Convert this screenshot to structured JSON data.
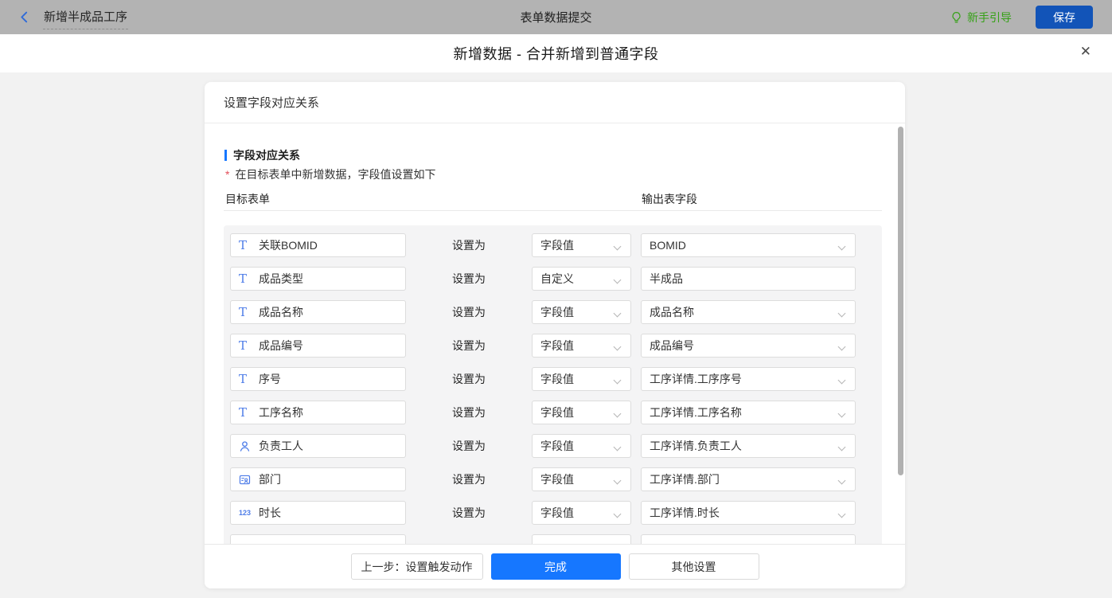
{
  "topbar": {
    "back_title": "新增半成品工序",
    "center_title": "表单数据提交",
    "guide_label": "新手引导",
    "save_label": "保存",
    "colors": {
      "bar_bg": "#b3b3b3",
      "save_bg": "#1254b8",
      "guide_green": "#35a116",
      "back_blue": "#2f6bd8"
    }
  },
  "modal": {
    "title": "新增数据 - 合并新增到普通字段",
    "close_glyph": "✕"
  },
  "panel": {
    "header": "设置字段对应关系",
    "section_title": "字段对应关系",
    "required_mark": "*",
    "required_note": "在目标表单中新增数据，字段值设置如下",
    "col_left": "目标表单",
    "col_right": "输出表字段"
  },
  "mapping": {
    "set_label": "设置为",
    "rows": [
      {
        "icon": "text-field-icon",
        "field": "关联BOMID",
        "mode": "字段值",
        "value": "BOMID",
        "value_type": "select"
      },
      {
        "icon": "text-field-icon",
        "field": "成品类型",
        "mode": "自定义",
        "value": "半成品",
        "value_type": "input"
      },
      {
        "icon": "text-field-icon",
        "field": "成品名称",
        "mode": "字段值",
        "value": "成品名称",
        "value_type": "select"
      },
      {
        "icon": "text-field-icon",
        "field": "成品编号",
        "mode": "字段值",
        "value": "成品编号",
        "value_type": "select"
      },
      {
        "icon": "text-field-icon",
        "field": "序号",
        "mode": "字段值",
        "value": "工序详情.工序序号",
        "value_type": "select"
      },
      {
        "icon": "text-field-icon",
        "field": "工序名称",
        "mode": "字段值",
        "value": "工序详情.工序名称",
        "value_type": "select"
      },
      {
        "icon": "member-icon",
        "field": "负责工人",
        "mode": "字段值",
        "value": "工序详情.负责工人",
        "value_type": "select"
      },
      {
        "icon": "department-icon",
        "field": "部门",
        "mode": "字段值",
        "value": "工序详情.部门",
        "value_type": "select"
      },
      {
        "icon": "number-icon",
        "field": "时长",
        "mode": "字段值",
        "value": "工序详情.时长",
        "value_type": "select"
      }
    ]
  },
  "footer": {
    "prev_label": "上一步：设置触发动作",
    "done_label": "完成",
    "other_label": "其他设置",
    "colors": {
      "done_bg": "#1677ff"
    }
  }
}
